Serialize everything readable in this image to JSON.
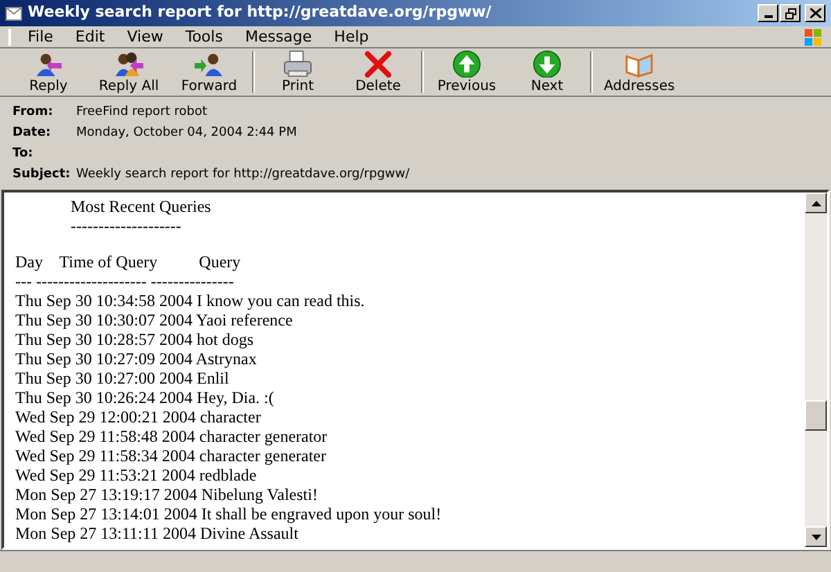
{
  "window": {
    "title": "Weekly search report for http://greatdave.org/rpgww/"
  },
  "menu": [
    "File",
    "Edit",
    "View",
    "Tools",
    "Message",
    "Help"
  ],
  "toolbar": [
    {
      "label": "Reply",
      "kind": "reply"
    },
    {
      "label": "Reply All",
      "kind": "replyall"
    },
    {
      "label": "Forward",
      "kind": "forward"
    },
    {
      "label": "Print",
      "kind": "print"
    },
    {
      "label": "Delete",
      "kind": "delete"
    },
    {
      "label": "Previous",
      "kind": "previous"
    },
    {
      "label": "Next",
      "kind": "next"
    },
    {
      "label": "Addresses",
      "kind": "addresses"
    }
  ],
  "headers": [
    {
      "label": "From:",
      "value": "FreeFind report robot"
    },
    {
      "label": "Date:",
      "value": "Monday, October 04, 2004 2:44 PM"
    },
    {
      "label": "To:"
    },
    {
      "label": "Subject:",
      "value": "Weekly search report for http://greatdave.org/rpgww/"
    }
  ],
  "report": {
    "title": "Most Recent Queries",
    "title_rule": "--------------------",
    "column_header": "Day    Time of Query          Query",
    "column_rule": "--- -------------------- ---------------",
    "rows": [
      "Thu Sep 30 10:34:58 2004 I know you can read this.",
      "Thu Sep 30 10:30:07 2004 Yaoi reference",
      "Thu Sep 30 10:28:57 2004 hot dogs",
      "Thu Sep 30 10:27:09 2004 Astrynax",
      "Thu Sep 30 10:27:00 2004 Enlil",
      "Thu Sep 30 10:26:24 2004 Hey, Dia. :(",
      "Wed Sep 29 12:00:21 2004 character",
      "Wed Sep 29 11:58:48 2004 character generator",
      "Wed Sep 29 11:58:34 2004 character generater",
      "Wed Sep 29 11:53:21 2004 redblade",
      "Mon Sep 27 13:19:17 2004 Nibelung Valesti!",
      "Mon Sep 27 13:14:01 2004 It shall be engraved upon your soul!",
      "Mon Sep 27 13:11:11 2004 Divine Assault"
    ]
  }
}
